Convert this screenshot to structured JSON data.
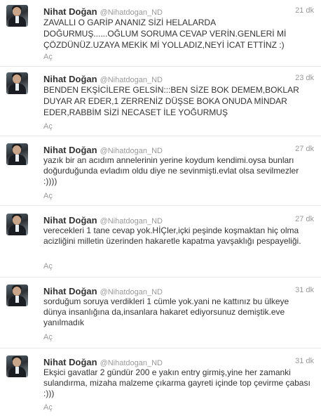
{
  "tweets": [
    {
      "name": "Nihat Doğan",
      "handle": "@Nihatdogan_ND",
      "time": "21 dk",
      "text": "ZAVALLI O GARİP ANANIZ SİZİ HELALARDA DOĞURMUŞ......OĞLUM SORUMA CEVAP VERİN.GENLERİ Mİ ÇÖZDÜNÜZ.UZAYA MEKİK Mİ YOLLADIZ,NEYİ İCAT ETTİNZ :)",
      "action": "Aç"
    },
    {
      "name": "Nihat Doğan",
      "handle": "@Nihatdogan_ND",
      "time": "23 dk",
      "text": "BENDEN EKŞİCİLERE GELSİN:::BEN SİZE BOK DEMEM,BOKLAR DUYAR AR EDER,1 ZERRENİZ DÜŞSE BOKA ONUDA MİNDAR EDER,RABBİM SİZİ NECASET İLE YOĞURMUŞ",
      "action": "Aç"
    },
    {
      "name": "Nihat Doğan",
      "handle": "@Nihatdogan_ND",
      "time": "27 dk",
      "text": "yazık bir an acıdım annelerinin yerine koydum kendimi.oysa bunları doğurduğunda evladım oldu diye ne sevinmişti.evlat olsa sevilmezler :))))",
      "action": "Aç"
    },
    {
      "name": "Nihat Doğan",
      "handle": "@Nihatdogan_ND",
      "time": "27 dk",
      "text": "verecekleri 1 tane cevap yok.HİÇler,içki peşinde koşmaktan hiç olma acizliğini milletin üzerinden hakaretle kapatma yavşaklığı pespayeliği.",
      "action": "Aç"
    },
    {
      "name": "Nihat Doğan",
      "handle": "@Nihatdogan_ND",
      "time": "31 dk",
      "text": "sorduğum soruya verdikleri 1 cümle yok.yani ne kattınız bu ülkeye dünya insanlığına da,insanlara hakaret ediyorsunuz demiştik.eve yanılmadık",
      "action": "Aç"
    },
    {
      "name": "Nihat Doğan",
      "handle": "@Nihatdogan_ND",
      "time": "31 dk",
      "text": "Ekşici gavatlar 2 gündür 200 e yakın entry girmiş,yine her zamanki sulandırma, mizaha malzeme çıkarma gayreti içinde top çevirme çabası :)))",
      "action": "Aç"
    }
  ]
}
